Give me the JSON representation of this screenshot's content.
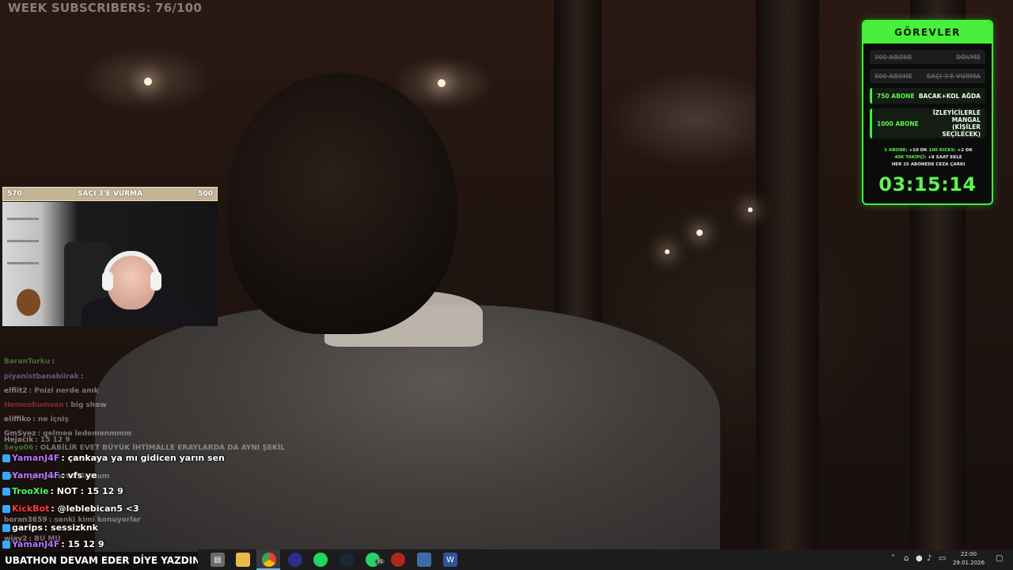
{
  "overlay": {
    "week_subscribers": "WEEK SUBSCRIBERS: 76/100"
  },
  "goals": {
    "title": "GÖREVLER",
    "rows": [
      {
        "amount": "300 ABONE",
        "reward": "DÖVME",
        "status": "done"
      },
      {
        "amount": "500 ABONE",
        "reward": "SAÇI 3'E VURMA",
        "status": "done"
      },
      {
        "amount": "750 ABONE",
        "reward": "BACAK+KOL AĞDA",
        "status": "active"
      },
      {
        "amount": "1000 ABONE",
        "reward": "İZLEYİCİLERLE MANGAL (KİŞİLER SEÇİLECEK)",
        "status": "active"
      }
    ],
    "rule1_a": "1 ABONE",
    "rule1_b": ": +10 DK",
    "rule1_c": "100 KICKS",
    "rule1_d": ": +2 DK",
    "rule2_a": "40K TAKİPÇİ",
    "rule2_b": ": +8 SAAT EKLE",
    "rule3": "HER 25 ABONEDE CEZA ÇARKI",
    "timer": "03:15:14"
  },
  "goal_bar": {
    "current": "570",
    "label": "SAÇI 3'E VURMA",
    "target": "500",
    "progress": 1.0
  },
  "chat": {
    "messages": [
      {
        "user": "BaranTurku",
        "text": ":",
        "color": "#6fdc6f",
        "style": "faded"
      },
      {
        "user": "piyanistbanabiirak",
        "text": ":",
        "color": "#c8a2ff",
        "style": "faded"
      },
      {
        "user": "elfiit2",
        "text": ": Poizi nerde amk",
        "color": "#ffffff",
        "style": "faded"
      },
      {
        "user": "Hemenhumsen",
        "text": ": big show",
        "color": "#ff4d4d",
        "style": "faded"
      },
      {
        "user": "eliffiko",
        "text": ": ne içniş",
        "color": "#ffffff",
        "style": "faded"
      },
      {
        "user": "GmSyez",
        "text": ": gelmee ledemenmmm",
        "color": "#ffffff",
        "style": "faded"
      },
      {
        "user": "Hejacik",
        "text": ": 15 12 9",
        "color": "#ffffff",
        "style": "faded"
      },
      {
        "user": "Seyo06",
        "text": ": OLABİLİR EVET BÜYÜK İHTİMALLE ERAYLARDA DA AYNI ŞEKİL",
        "color": "#6fdc6f",
        "style": "faded"
      },
      {
        "user": "YamanJ4F",
        "text": ": çankaya ya mı gidicen yarın sen",
        "color": "#b873ff",
        "style": "big"
      },
      {
        "user": "Arka",
        "text": ": göster artık dostum",
        "color": "#ffffff",
        "style": "faded"
      },
      {
        "user": "YamanJ4F",
        "text": ": vfs ye",
        "color": "#b873ff",
        "style": "big"
      },
      {
        "user": "TrooXie",
        "text": ": NOT : 15 12 9",
        "color": "#4dff5a",
        "style": "big"
      },
      {
        "user": "KickBot",
        "text": ": @leblebican5 <3",
        "color": "#ff3b3b",
        "style": "big"
      },
      {
        "user": "boran3659",
        "text": ": sanki kimi konuyorlar",
        "color": "#ffffff",
        "style": "faded"
      },
      {
        "user": "garips",
        "text": ": sessizknk",
        "color": "#ffffff",
        "style": "big"
      },
      {
        "user": "wiay2",
        "text": ": BU MU",
        "color": "#ffffff",
        "style": "faded"
      },
      {
        "user": "YamanJ4F",
        "text": ": 15 12 9",
        "color": "#b873ff",
        "style": "big"
      }
    ]
  },
  "ticker": "UBATHON DEVAM EDER DİYE YAZDIN DE Mİ",
  "taskbar": {
    "icons": [
      "file-explorer-icon",
      "folder-icon",
      "chrome-icon",
      "obs-icon",
      "spotify-icon",
      "steam-icon",
      "whatsapp-icon",
      "app-icon",
      "network-app-icon",
      "word-icon"
    ],
    "whatsapp_badge": "35",
    "clock_time": "22:00",
    "clock_date": "29.01.2026"
  }
}
